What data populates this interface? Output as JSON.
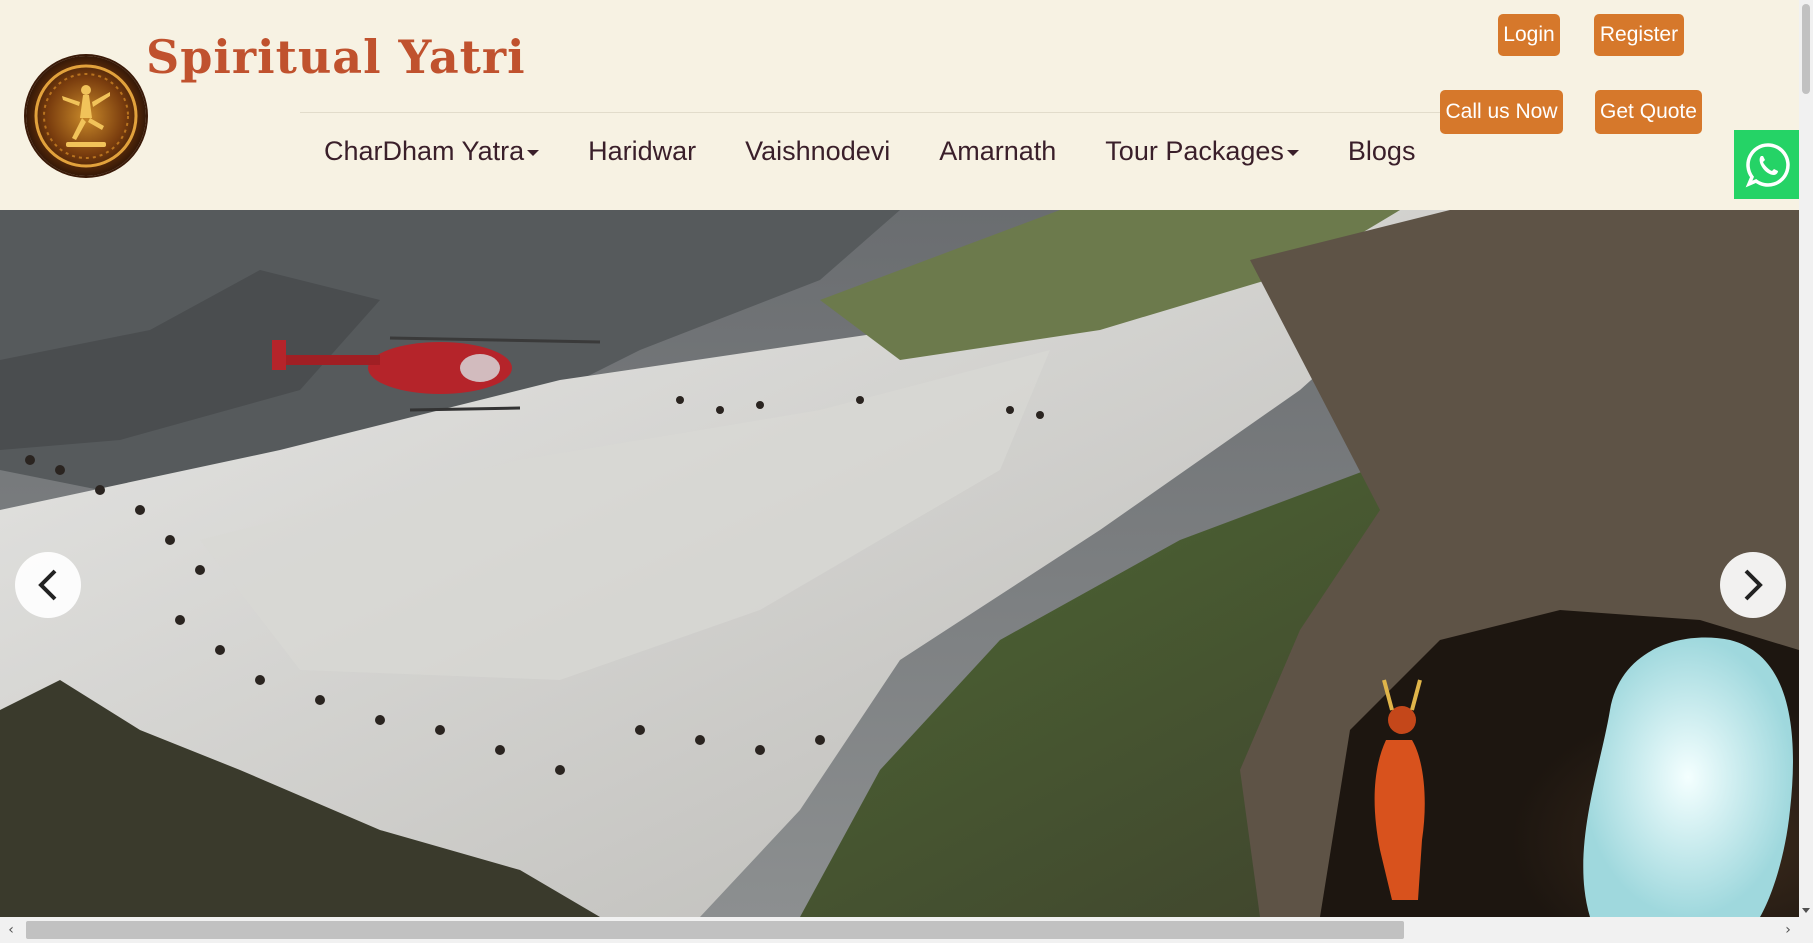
{
  "site": {
    "brand": "Spiritual Yatri",
    "logo_icon": "nataraja-logo"
  },
  "auth": {
    "login_label": "Login",
    "register_label": "Register"
  },
  "cta": {
    "call_label": "Call us Now",
    "quote_label": "Get Quote"
  },
  "nav": {
    "items": [
      {
        "label": "CharDham Yatra",
        "dropdown": true
      },
      {
        "label": "Haridwar",
        "dropdown": false
      },
      {
        "label": "Vaishnodevi",
        "dropdown": false
      },
      {
        "label": "Amarnath",
        "dropdown": false
      },
      {
        "label": "Tour Packages",
        "dropdown": true
      },
      {
        "label": "Blogs",
        "dropdown": false
      }
    ]
  },
  "whatsapp": {
    "icon": "whatsapp-icon"
  },
  "slider": {
    "prev_icon": "chevron-left-icon",
    "next_icon": "chevron-right-icon"
  },
  "colors": {
    "header_bg": "#f7f2e3",
    "brand": "#c0522e",
    "button": "#d6782b",
    "nav_text": "#3a1f2a",
    "whatsapp": "#25d366"
  }
}
